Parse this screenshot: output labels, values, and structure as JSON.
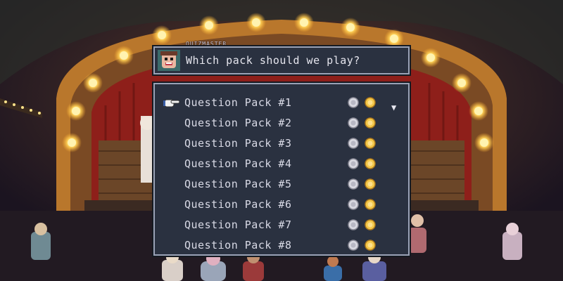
{
  "dialog": {
    "speaker": "QUIZMASTER",
    "question": "Which pack should we play?"
  },
  "menu": {
    "items": [
      {
        "label": "Question Pack #1",
        "selected": true
      },
      {
        "label": "Question Pack #2"
      },
      {
        "label": "Question Pack #3"
      },
      {
        "label": "Question Pack #4"
      },
      {
        "label": "Question Pack #5"
      },
      {
        "label": "Question Pack #6"
      },
      {
        "label": "Question Pack #7"
      },
      {
        "label": "Question Pack #8"
      }
    ],
    "medals": [
      "silver-medal-icon",
      "gold-medal-icon"
    ],
    "scroll_indicator": "scroll-down-arrow-icon"
  },
  "colors": {
    "panel_bg": "#2a3140",
    "panel_border": "#9aa2b6",
    "text": "#d9dae6",
    "stage_curtain": "#8e1f1a",
    "marquee_bulb": "#ffd35a"
  }
}
